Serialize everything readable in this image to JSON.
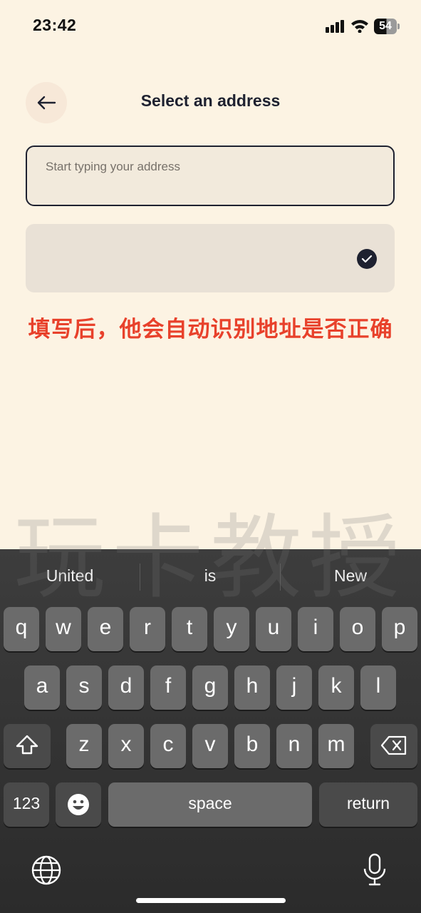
{
  "status_bar": {
    "time": "23:42",
    "battery": "54"
  },
  "header": {
    "title": "Select an address",
    "back_icon": "arrow-left-icon"
  },
  "address_input": {
    "placeholder": "Start typing your address",
    "value": ""
  },
  "suggestion": {
    "check_icon": "check-circle-icon"
  },
  "annotation": {
    "text": "填写后，他会自动识别地址是否正确",
    "color": "#e8412b"
  },
  "watermark": {
    "text": "玩卡教授"
  },
  "keyboard": {
    "predictions": [
      "United",
      "is",
      "New"
    ],
    "row1": [
      "q",
      "w",
      "e",
      "r",
      "t",
      "y",
      "u",
      "i",
      "o",
      "p"
    ],
    "row2": [
      "a",
      "s",
      "d",
      "f",
      "g",
      "h",
      "j",
      "k",
      "l"
    ],
    "row3": [
      "z",
      "x",
      "c",
      "v",
      "b",
      "n",
      "m"
    ],
    "numbers_label": "123",
    "space_label": "space",
    "return_label": "return"
  },
  "colors": {
    "background": "#fcf3e3",
    "accent_dark": "#1e2130",
    "keyboard_bg": "#2b2b2b"
  }
}
